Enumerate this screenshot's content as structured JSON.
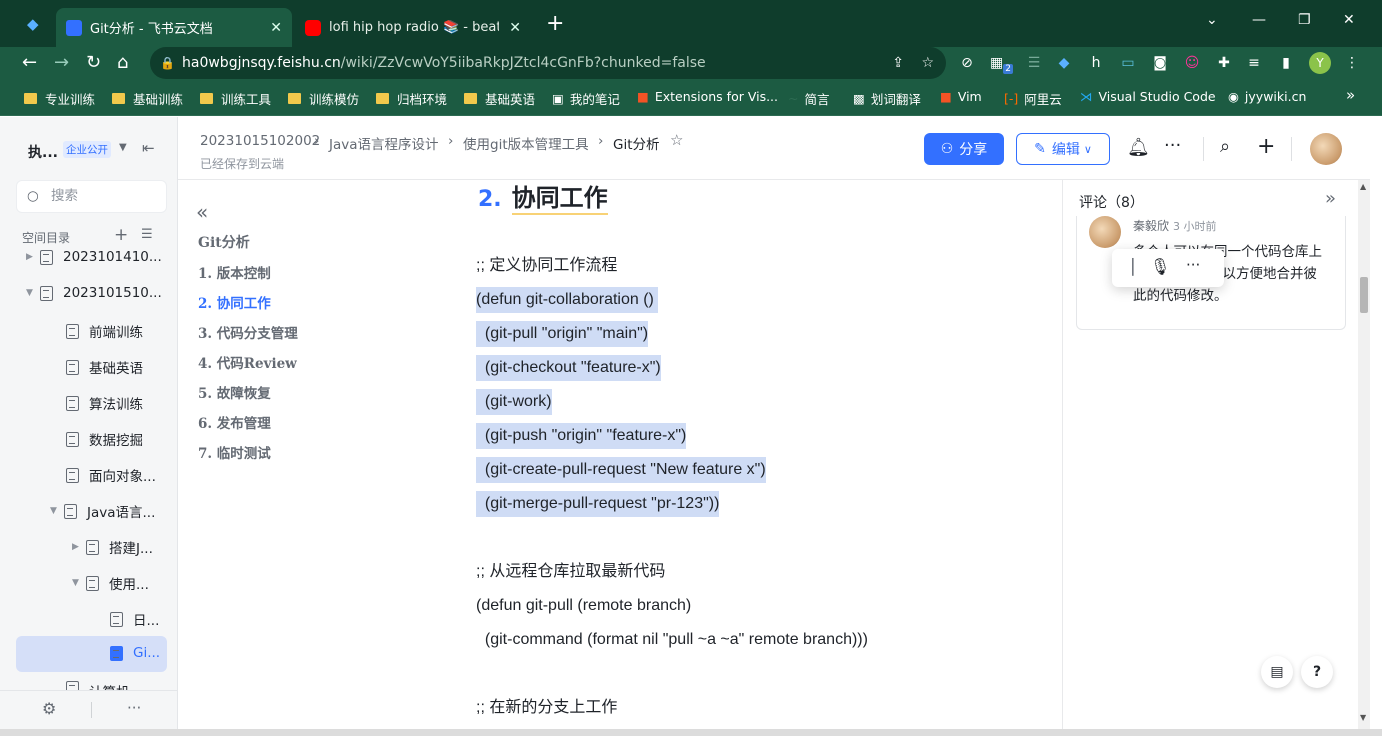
{
  "browser": {
    "tabs": [
      {
        "title": "Git分析 - 飞书云文档",
        "active": true
      },
      {
        "title": "lofi hip hop radio 📚 - beats t",
        "active": false
      }
    ],
    "new_tab": "+",
    "url_host": "ha0wbgjnsqy.feishu.cn",
    "url_path": "/wiki/ZzVcwVoY5iibaRkpJZtcl4cGnFb?chunked=false",
    "extension_badge": "2",
    "profile_initial": "Y",
    "bookmarks": [
      "专业训练",
      "基础训练",
      "训练工具",
      "训练模仿",
      "归档环境",
      "基础英语",
      "我的笔记",
      "Extensions for Vis...",
      "简言",
      "划词翻译",
      "Vim",
      "阿里云",
      "Visual Studio Code",
      "jyywiki.cn"
    ],
    "bookmarks_more": "»"
  },
  "sidebar": {
    "space_title": "执...",
    "space_badge": "企业公开",
    "search_placeholder": "搜索",
    "section_title": "空间目录",
    "items": [
      {
        "label": "2023101410..."
      },
      {
        "label": "2023101510..."
      },
      {
        "label": "前端训练"
      },
      {
        "label": "基础英语"
      },
      {
        "label": "算法训练"
      },
      {
        "label": "数据挖掘"
      },
      {
        "label": "面向对象..."
      },
      {
        "label": "Java语言..."
      },
      {
        "label": "搭建J..."
      },
      {
        "label": "使用..."
      },
      {
        "label": "日..."
      },
      {
        "label": "Gi..."
      },
      {
        "label": "计算机..."
      }
    ],
    "more": "···"
  },
  "header": {
    "breadcrumbs": [
      "20231015102002",
      "Java语言程序设计",
      "使用git版本管理工具",
      "Git分析"
    ],
    "saved_status": "已经保存到云端",
    "share_label": "分享",
    "edit_label": "编辑"
  },
  "outline": {
    "title": "Git分析",
    "items": [
      "1. 版本控制",
      "2. 协同工作",
      "3. 代码分支管理",
      "4. 代码Review",
      "5. 故障恢复",
      "6. 发布管理",
      "7. 临时测试"
    ],
    "active_index": 1
  },
  "doc": {
    "heading_number": "2.",
    "heading_text": "协同工作",
    "lines": [
      {
        "text": ";; 定义协同工作流程",
        "hl": false
      },
      {
        "text": "(defun git-collaboration ()",
        "hl": true
      },
      {
        "text": "  (git-pull \"origin\" \"main\")",
        "hl": true
      },
      {
        "text": "  (git-checkout \"feature-x\")",
        "hl": true
      },
      {
        "text": "  (git-work)",
        "hl": true
      },
      {
        "text": "  (git-push \"origin\" \"feature-x\")",
        "hl": true
      },
      {
        "text": "  (git-create-pull-request \"New feature x\")",
        "hl": true
      },
      {
        "text": "  (git-merge-pull-request \"pr-123\"))",
        "hl": true
      },
      {
        "text": "",
        "hl": false
      },
      {
        "text": ";; 从远程仓库拉取最新代码",
        "hl": false
      },
      {
        "text": "(defun git-pull (remote branch)",
        "hl": false
      },
      {
        "text": "  (git-command (format nil \"pull ~a ~a\" remote branch)))",
        "hl": false
      },
      {
        "text": "",
        "hl": false
      },
      {
        "text": ";; 在新的分支上工作",
        "hl": false
      }
    ]
  },
  "comments": {
    "title": "评论（8）",
    "author": "秦毅欣",
    "time": "3 小时前",
    "text_line1": "多个人可以在同一个代码仓库上",
    "text_line2": "可以方便地合并彼",
    "text_line3": "此的代码修改。"
  },
  "colors": {
    "brand": "#3370ff",
    "chrome_dark": "#0f3d2c",
    "chrome": "#1c5b42",
    "highlight": "#cfdcf5"
  }
}
